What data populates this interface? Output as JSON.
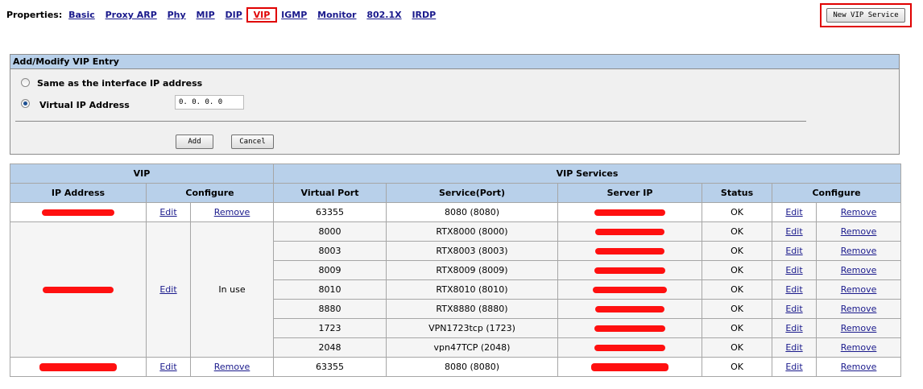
{
  "properties": {
    "label": "Properties:",
    "tabs": [
      "Basic",
      "Proxy ARP",
      "Phy",
      "MIP",
      "DIP",
      "VIP",
      "IGMP",
      "Monitor",
      "802.1X",
      "IRDP"
    ],
    "active_tab": "VIP"
  },
  "new_vip_button": "New VIP Service",
  "form": {
    "title": "Add/Modify VIP Entry",
    "option_same": "Same as the interface IP address",
    "option_virtual": "Virtual IP Address",
    "selected_option": "Virtual IP Address",
    "ip_value": "0. 0. 0. 0",
    "add_label": "Add",
    "cancel_label": "Cancel"
  },
  "table": {
    "group_headers": [
      "VIP",
      "VIP Services"
    ],
    "headers": [
      "IP Address",
      "Configure",
      "Virtual Port",
      "Service(Port)",
      "Server IP",
      "Status",
      "Configure"
    ],
    "edit_label": "Edit",
    "remove_label": "Remove",
    "in_use_label": "In use",
    "vip_groups": [
      {
        "ip_address": "(redacted)",
        "configure": [
          "Edit",
          "Remove"
        ],
        "services": [
          {
            "virtual_port": "63355",
            "service": "8080 (8080)",
            "server_ip": "(redacted)",
            "status": "OK"
          }
        ]
      },
      {
        "ip_address": "(redacted)",
        "configure": [
          "Edit",
          "In use"
        ],
        "services": [
          {
            "virtual_port": "8000",
            "service": "RTX8000 (8000)",
            "server_ip": "(redacted)",
            "status": "OK"
          },
          {
            "virtual_port": "8003",
            "service": "RTX8003 (8003)",
            "server_ip": "(redacted)",
            "status": "OK"
          },
          {
            "virtual_port": "8009",
            "service": "RTX8009 (8009)",
            "server_ip": "(redacted)",
            "status": "OK"
          },
          {
            "virtual_port": "8010",
            "service": "RTX8010 (8010)",
            "server_ip": "(redacted)",
            "status": "OK"
          },
          {
            "virtual_port": "8880",
            "service": "RTX8880 (8880)",
            "server_ip": "(redacted)",
            "status": "OK"
          },
          {
            "virtual_port": "1723",
            "service": "VPN1723tcp (1723)",
            "server_ip": "(redacted)",
            "status": "OK"
          },
          {
            "virtual_port": "2048",
            "service": "vpn47TCP (2048)",
            "server_ip": "(redacted)",
            "status": "OK"
          }
        ]
      },
      {
        "ip_address": "(redacted)",
        "configure": [
          "Edit",
          "Remove"
        ],
        "services": [
          {
            "virtual_port": "63355",
            "service": "8080 (8080)",
            "server_ip": "(redacted)",
            "status": "OK"
          }
        ]
      }
    ]
  },
  "colors": {
    "header_bg": "#b8d0ea",
    "link": "#1a1a8c",
    "active_tab": "#e00000",
    "redaction": "#ff1010"
  }
}
